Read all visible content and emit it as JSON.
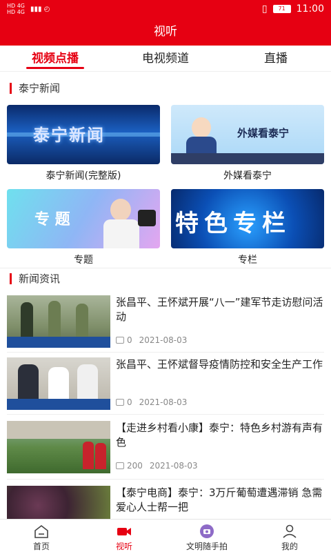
{
  "status_bar": {
    "signal_left": "HD 4G\nHD 4G",
    "battery": "71",
    "time": "11:00"
  },
  "header": {
    "title": "视听"
  },
  "tabs": [
    {
      "label": "视频点播",
      "active": true
    },
    {
      "label": "电视频道",
      "active": false
    },
    {
      "label": "直播",
      "active": false
    }
  ],
  "sections": {
    "programs_title": "泰宁新闻",
    "news_title": "新闻资讯"
  },
  "programs": [
    {
      "caption": "泰宁新闻(完整版)",
      "thumb_text": "泰宁新闻"
    },
    {
      "caption": "外媒看泰宁",
      "thumb_text": "外媒看泰宁"
    },
    {
      "caption": "专题",
      "thumb_text": "专 题"
    },
    {
      "caption": "专栏",
      "thumb_text": "特色专栏"
    }
  ],
  "news": [
    {
      "title": "张昌平、王怀斌开展“八一”建军节走访慰问活动",
      "comments": "0",
      "date": "2021-08-03"
    },
    {
      "title": " 张昌平、王怀斌督导疫情防控和安全生产工作",
      "comments": "0",
      "date": "2021-08-03"
    },
    {
      "title": "【走进乡村看小康】泰宁：特色乡村游有声有色",
      "comments": "200",
      "date": "2021-08-03"
    },
    {
      "title": "【泰宁电商】泰宁：3万斤葡萄遭遇滞销 急需爱心人士帮一把",
      "comments": "",
      "date": ""
    }
  ],
  "bottom_nav": [
    {
      "label": "首页",
      "icon": "home-icon",
      "active": false
    },
    {
      "label": "视听",
      "icon": "video-camera-icon",
      "active": true
    },
    {
      "label": "文明随手拍",
      "icon": "camera-badge-icon",
      "active": false
    },
    {
      "label": "我的",
      "icon": "user-icon",
      "active": false
    }
  ],
  "colors": {
    "brand": "#e60012"
  }
}
